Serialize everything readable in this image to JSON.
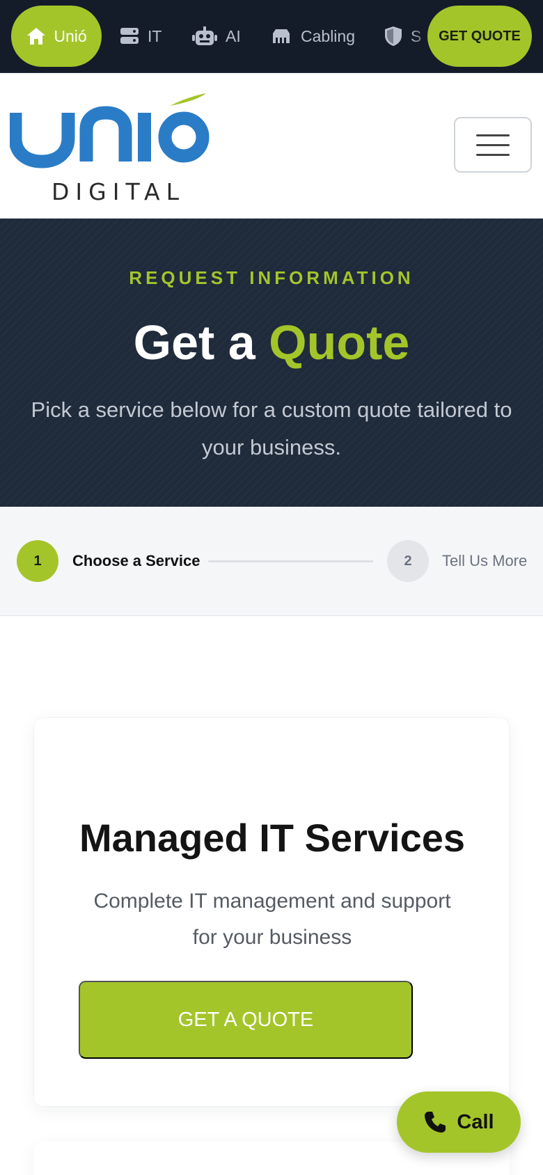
{
  "topnav": {
    "home_label": "Unió",
    "items": [
      {
        "label": "IT",
        "icon": "server-icon"
      },
      {
        "label": "AI",
        "icon": "robot-icon"
      },
      {
        "label": "Cabling",
        "icon": "network-cabling-icon"
      },
      {
        "label": "S",
        "icon": "shield-icon"
      }
    ],
    "quote_label": "GET QUOTE"
  },
  "header": {
    "logo_word": "Unió",
    "logo_sub": "DIGITAL",
    "menu_icon": "hamburger-icon"
  },
  "hero": {
    "eyebrow": "REQUEST INFORMATION",
    "title_plain": "Get a",
    "title_accent": "Quote",
    "subtitle": "Pick a service below for a custom quote tailored to your business."
  },
  "stepper": {
    "steps": [
      {
        "number": "1",
        "label": "Choose a Service",
        "active": true
      },
      {
        "number": "2",
        "label": "Tell Us More",
        "active": false
      }
    ]
  },
  "card": {
    "title": "Managed IT Services",
    "description": "Complete IT management and support for your business",
    "button_label": "GET A QUOTE"
  },
  "call": {
    "label": "Call",
    "icon": "phone-icon"
  },
  "colors": {
    "accent": "#a4c52a",
    "brand_blue": "#2a7cc6",
    "dark_bg": "#141c2a",
    "hero_bg": "#1f2a3b"
  }
}
